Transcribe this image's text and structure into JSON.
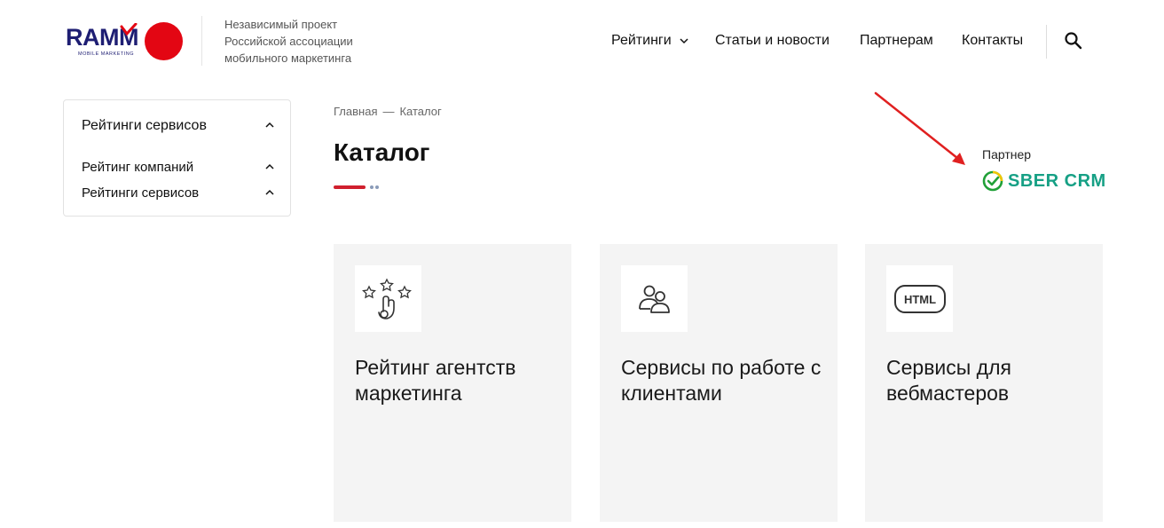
{
  "header": {
    "logo": {
      "text": "RAMM",
      "subtext": "MOBILE MARKETING"
    },
    "tagline": [
      "Независимый проект",
      "Российской ассоциации",
      "мобильного маркетинга"
    ],
    "nav": [
      {
        "label": "Рейтинги",
        "has_dropdown": true
      },
      {
        "label": "Статьи и новости"
      },
      {
        "label": "Партнерам"
      },
      {
        "label": "Контакты"
      }
    ],
    "search_icon": "search-icon"
  },
  "sidebar": {
    "title": "Рейтинги сервисов",
    "items": [
      {
        "label": "Рейтинг компаний"
      },
      {
        "label": "Рейтинги сервисов"
      }
    ]
  },
  "breadcrumb": {
    "items": [
      "Главная",
      "Каталог"
    ],
    "separator": "—"
  },
  "page_title": "Каталог",
  "partner": {
    "label": "Партнер",
    "logo_text": "SBER CRM"
  },
  "cards": [
    {
      "title": "Рейтинг агентств маркетинга",
      "icon": "stars-hand-icon"
    },
    {
      "title": "Сервисы по работе с клиентами",
      "icon": "users-icon"
    },
    {
      "title": "Сервисы для вебмастеров",
      "icon": "html-icon"
    }
  ],
  "colors": {
    "brand_navy": "#1e1e73",
    "brand_red": "#e30613",
    "accent_red": "#d0202e",
    "sber_green": "#16a085",
    "card_bg": "#f4f4f4"
  }
}
